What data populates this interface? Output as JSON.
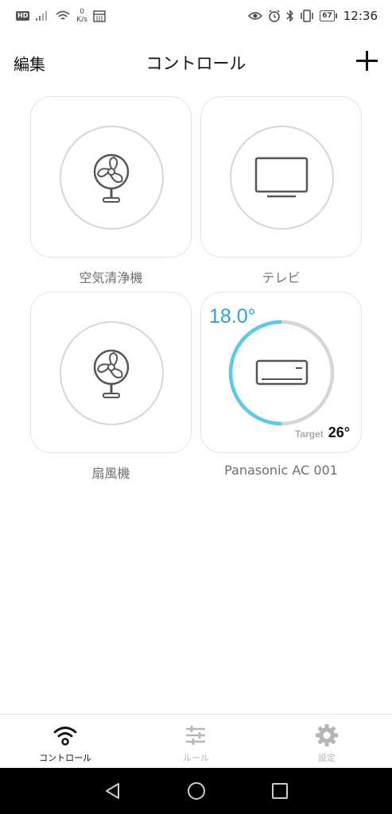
{
  "status_bar": {
    "hd": "HD",
    "speed_value": "0",
    "speed_unit": "K/s",
    "battery": "67",
    "time": "12:36"
  },
  "header": {
    "edit_label": "編集",
    "title": "コントロール"
  },
  "devices": [
    {
      "label": "空気清浄機",
      "icon": "fan-icon"
    },
    {
      "label": "テレビ",
      "icon": "tv-icon"
    },
    {
      "label": "扇風機",
      "icon": "fan-icon"
    },
    {
      "label": "Panasonic AC 001",
      "icon": "air-conditioner-icon",
      "current_temp": "18.0°",
      "target_label": "Target",
      "target_temp": "26°",
      "arc_color": "#5bc8ec"
    }
  ],
  "bottom_nav": [
    {
      "label": "コントロール",
      "icon": "wifi-icon",
      "active": true
    },
    {
      "label": "ルール",
      "icon": "sliders-icon",
      "active": false
    },
    {
      "label": "設定",
      "icon": "gear-icon",
      "active": false
    }
  ],
  "colors": {
    "accent": "#2aa3d8",
    "ring": "#d6d6d6",
    "icon_stroke": "#555555"
  }
}
